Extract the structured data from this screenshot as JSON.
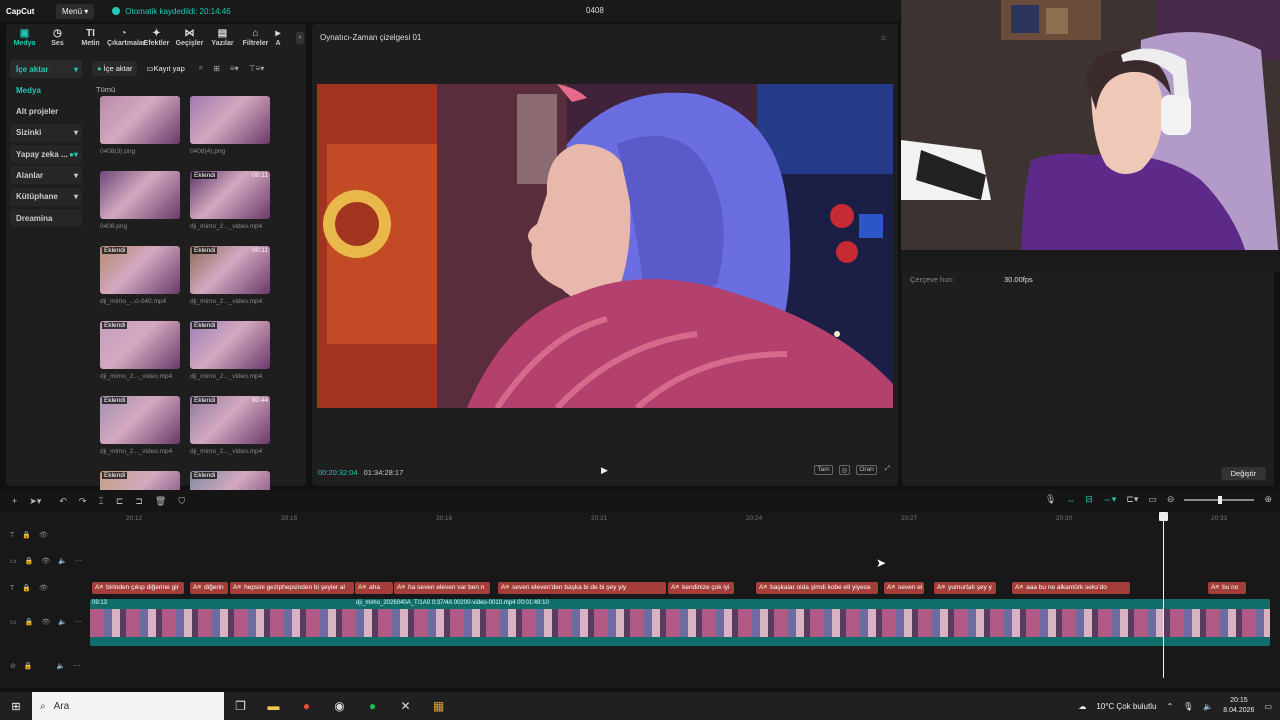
{
  "app": {
    "logo": "CapCut",
    "menu": "Menü",
    "autosave": "Otomatik kaydedildi: 20:14:46",
    "project": "0408"
  },
  "tabs": [
    {
      "label": "Medya",
      "icon": "media-icon"
    },
    {
      "label": "Ses",
      "icon": "audio-icon"
    },
    {
      "label": "Metin",
      "icon": "text-icon"
    },
    {
      "label": "Çıkartmalar",
      "icon": "sticker-icon"
    },
    {
      "label": "Efektler",
      "icon": "effects-icon"
    },
    {
      "label": "Geçişler",
      "icon": "transitions-icon"
    },
    {
      "label": "Yazılar",
      "icon": "captions-icon"
    },
    {
      "label": "Filtreler",
      "icon": "filters-icon"
    },
    {
      "label": "A",
      "icon": "more-icon"
    }
  ],
  "sidebar": [
    {
      "label": "İçe aktar"
    },
    {
      "label": "Medya"
    },
    {
      "label": "Alt projeler"
    },
    {
      "label": "Sizinki"
    },
    {
      "label": "Yapay zeka ..."
    },
    {
      "label": "Alanlar"
    },
    {
      "label": "Kütüphane"
    },
    {
      "label": "Dreamina"
    }
  ],
  "media_toolbar": {
    "import": "İçe aktar",
    "record": "Kayıt yap"
  },
  "media_filter": "Tümü",
  "media": [
    {
      "name": "0408(3).png",
      "badge": "",
      "dur": ""
    },
    {
      "name": "0408(4).png",
      "badge": "",
      "dur": ""
    },
    {
      "name": "0408.png",
      "badge": "",
      "dur": ""
    },
    {
      "name": "dji_mimo_2..._video.mp4",
      "badge": "Eklendi",
      "dur": "00:11"
    },
    {
      "name": "dji_mimo_...o-040.mp4",
      "badge": "Eklendi",
      "dur": ""
    },
    {
      "name": "dji_mimo_2..._video.mp4",
      "badge": "Eklendi",
      "dur": "00:11"
    },
    {
      "name": "dji_mimo_2..._video.mp4",
      "badge": "Eklendi",
      "dur": ""
    },
    {
      "name": "dji_mimo_2..._video.mp4",
      "badge": "Eklendi",
      "dur": ""
    },
    {
      "name": "dji_mimo_2..._video.mp4",
      "badge": "Eklendi",
      "dur": ""
    },
    {
      "name": "dji_mimo_2..._video.mp4",
      "badge": "Eklendi",
      "dur": "00:44"
    },
    {
      "name": "",
      "badge": "Eklendi",
      "dur": ""
    },
    {
      "name": "",
      "badge": "Eklendi",
      "dur": ""
    }
  ],
  "player": {
    "title": "Oynatıcı-Zaman çizelgesi 01",
    "current": "00:20:32:04",
    "total": "01:34:28:17",
    "full": "Tam",
    "ratio": "Oran"
  },
  "details": {
    "fps_label": "Çerçeve hızı:",
    "fps_value": "30.00fps",
    "change": "Değiştir"
  },
  "ruler": [
    "20:12",
    "20:15",
    "20:18",
    "20:21",
    "20:24",
    "20:27",
    "20:30",
    "20:33"
  ],
  "captions": [
    "birinden çıkıp diğerine gir",
    "diğerin",
    "hepsini geziphepsinden bi şeyler al",
    "aha",
    "ha seven eleven var ben n",
    "seven eleven'den başka bi de bi şey yiy",
    "kendinize çok iyi",
    "başkalar oida şimdi kobe eti yiyece",
    "seven el",
    "yumurtalı şey y",
    "aaa bu ne alkantürk seks'do",
    "bu no"
  ],
  "video_track": {
    "label": "09:13",
    "label2": "dji_mimo_2026040A_T/1A0 0:37/4A 00200-video-0010.mp4    00:01:49:10"
  },
  "taskbar": {
    "search": "Ara",
    "weather": "10°C  Çok bulutlu",
    "time": "20:15",
    "date": "8.04.2026"
  },
  "colors": {
    "accent": "#22c9b6",
    "caption": "#a43e3a",
    "track": "#0f6e6a"
  }
}
